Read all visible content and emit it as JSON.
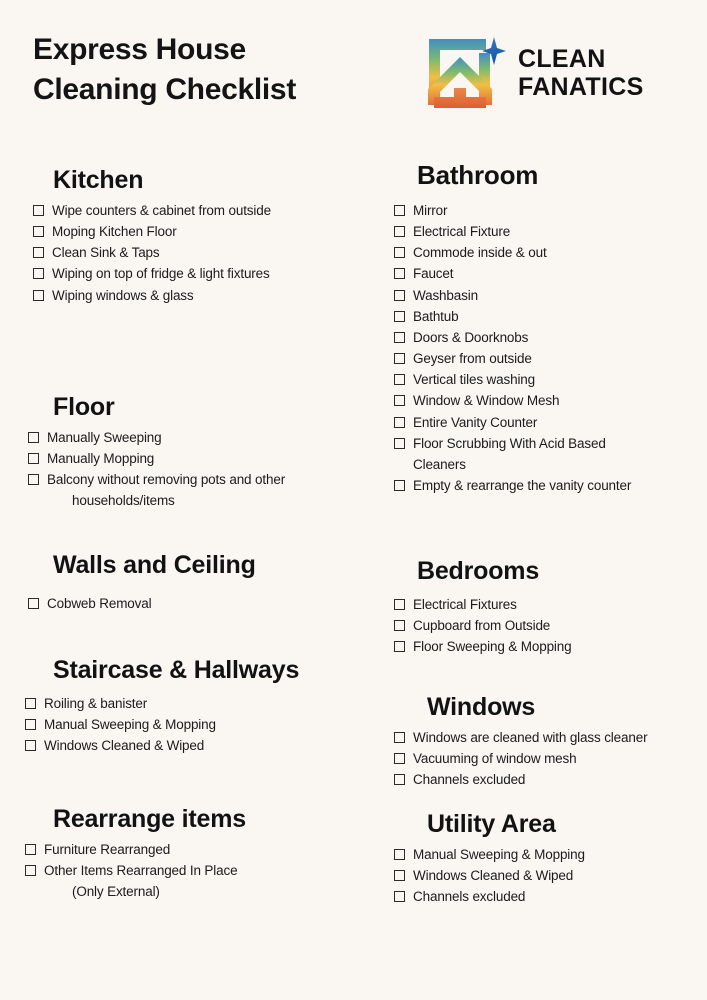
{
  "document": {
    "title_line1": "Express House",
    "title_line2": "Cleaning Checklist",
    "background_color": "#faf7f3",
    "text_color": "#1a1a1a"
  },
  "brand": {
    "name_line1": "CLEAN",
    "name_line2": "FANATICS",
    "logo_icon": "house-sparkle-logo",
    "logo_colors": {
      "top": "#3f8fc4",
      "mid_green": "#8cbf63",
      "mid_yellow": "#f0b93f",
      "bottom": "#e4703a",
      "sparkle": "#1c5fa8"
    }
  },
  "left_column": {
    "sections": [
      {
        "title": "Kitchen",
        "items": [
          "Wipe counters & cabinet from outside",
          "Moping Kitchen Floor",
          "Clean Sink & Taps",
          "Wiping on top of fridge & light fixtures",
          "Wiping  windows & glass"
        ]
      },
      {
        "title": "Floor",
        "items": [
          "Manually Sweeping",
          "Manually Mopping",
          "Balcony without removing pots and other"
        ],
        "continuation": "households/items"
      },
      {
        "title": "Walls and Ceiling",
        "items": [
          "Cobweb Removal"
        ]
      },
      {
        "title": "Staircase & Hallways",
        "items": [
          "Roiling & banister",
          "Manual Sweeping & Mopping",
          "Windows Cleaned & Wiped"
        ]
      },
      {
        "title": "Rearrange items",
        "items": [
          "Furniture Rearranged",
          " Other Items Rearranged In Place"
        ],
        "continuation": "(Only External)"
      }
    ]
  },
  "right_column": {
    "sections": [
      {
        "title": "Bathroom",
        "items": [
          "Mirror",
          "Electrical Fixture",
          "Commode inside & out",
          "Faucet",
          "Washbasin",
          "Bathtub",
          "Doors & Doorknobs",
          "Geyser from outside",
          "Vertical tiles washing",
          "Window & Window Mesh",
          "Entire Vanity Counter",
          "Floor Scrubbing With Acid Based",
          "Empty & rearrange the vanity counter"
        ],
        "wrapped_line": "Cleaners"
      },
      {
        "title": "Bedrooms",
        "items": [
          "Electrical Fixtures",
          "Cupboard from Outside",
          "Floor Sweeping & Mopping"
        ]
      },
      {
        "title": "Windows",
        "items": [
          "Windows are cleaned with glass cleaner",
          "Vacuuming of window mesh",
          "Channels excluded"
        ]
      },
      {
        "title": "Utility Area",
        "items": [
          "Manual Sweeping & Mopping",
          "Windows Cleaned & Wiped",
          "Channels excluded"
        ]
      }
    ]
  }
}
